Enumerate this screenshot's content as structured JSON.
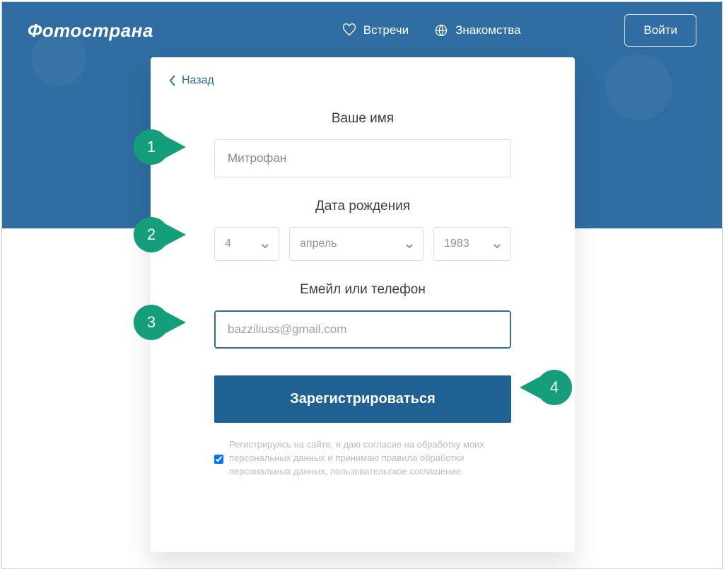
{
  "brand": {
    "logo": "Фотострана"
  },
  "nav": {
    "meet": "Встречи",
    "dating": "Знакомства"
  },
  "login_label": "Войти",
  "card": {
    "back": "Назад",
    "name_label": "Ваше имя",
    "name_value": "Митрофан",
    "dob_label": "Дата рождения",
    "dob": {
      "day": "4",
      "month": "апрель",
      "year": "1983"
    },
    "email_label": "Емейл или телефон",
    "email_value": "bazziliuss@gmail.com",
    "submit": "Зарегистрироваться",
    "consent": "Регистрируясь на сайте, я даю согласие на обработку моих персональных данных и принимаю правила обработки персональных данных, пользовательское соглашение."
  },
  "markers": {
    "m1": "1",
    "m2": "2",
    "m3": "3",
    "m4": "4"
  },
  "colors": {
    "accent": "#2f6da2",
    "marker": "#149e7a"
  }
}
